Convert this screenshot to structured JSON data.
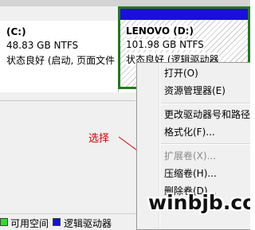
{
  "disk_map": {
    "volumes": [
      {
        "name": "(C:)",
        "size": "48.83 GB NTFS",
        "status": "状态良好 (启动, 页面文件",
        "header_color": "#f0f0f0",
        "selected": false
      },
      {
        "name": "LENOVO  (D:)",
        "size": "101.98 GB NTFS",
        "status": "状态良好 (逻辑驱动器",
        "header_color": "#1a10d8",
        "border_color": "#1f7a1f",
        "selected": true
      }
    ]
  },
  "legend": {
    "items": [
      {
        "label": "可用空间",
        "color": "#2edc2e"
      },
      {
        "label": "逻辑驱动器",
        "color": "#1010e8"
      }
    ]
  },
  "context_menu": {
    "items": [
      {
        "label": "打开(O)",
        "enabled": true
      },
      {
        "label": "资源管理器(E)",
        "enabled": true
      },
      {
        "label": "更改驱动器号和路径",
        "enabled": true
      },
      {
        "label": "格式化(F)...",
        "enabled": true
      },
      {
        "label": "扩展卷(X)...",
        "enabled": false
      },
      {
        "label": "压缩卷(H)...",
        "enabled": true
      },
      {
        "label": "删除卷(D)...",
        "enabled": true
      }
    ]
  },
  "annotation": {
    "label": "选择",
    "color": "#d00000",
    "target": "压缩卷(H)..."
  },
  "watermark": {
    "text": "winbjb.com"
  }
}
